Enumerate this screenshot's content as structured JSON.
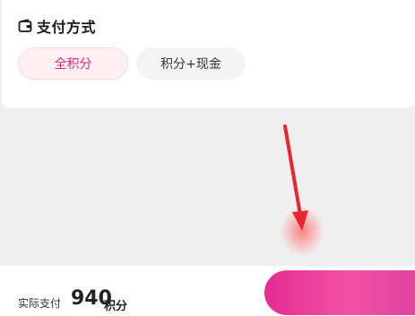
{
  "payment_method": {
    "title": "支付方式",
    "icon": "wallet-icon",
    "options": [
      {
        "label": "全积分",
        "selected": true
      },
      {
        "label": "积分+现金",
        "selected": false
      }
    ]
  },
  "footer": {
    "actual_pay_label": "实际支付",
    "amount": "940",
    "unit": "积分"
  },
  "colors": {
    "accent": "#e0267c",
    "selected_bg": "#fff0f4",
    "arrow": "#e8262f",
    "button_gradient_start": "#e6208e",
    "button_gradient_end": "#f0479f"
  }
}
